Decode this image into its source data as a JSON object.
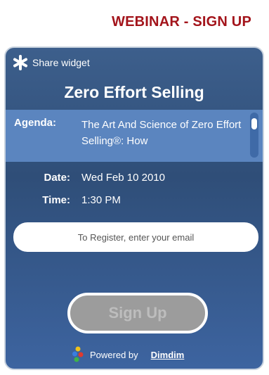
{
  "header": {
    "title": "WEBINAR - SIGN UP"
  },
  "widget": {
    "share_label": "Share widget",
    "share_icon": "asterisk-icon",
    "title": "Zero Effort Selling",
    "agenda": {
      "label": "Agenda:",
      "text": "The Art And Science of Zero Effort Selling®: How"
    },
    "date": {
      "label": "Date:",
      "value": "Wed Feb 10 2010"
    },
    "time": {
      "label": "Time:",
      "value": "1:30 PM"
    },
    "email": {
      "placeholder": "To Register, enter your email",
      "value": ""
    },
    "signup_label": "Sign Up",
    "powered": {
      "label": "Powered by",
      "link": "Dimdim",
      "logo_icon": "dimdim-logo-icon"
    }
  },
  "colors": {
    "header_red": "#a3141b",
    "widget_blue": "#2f4e78",
    "agenda_band": "#5b85bf",
    "button_gray": "#9c9c9c"
  }
}
